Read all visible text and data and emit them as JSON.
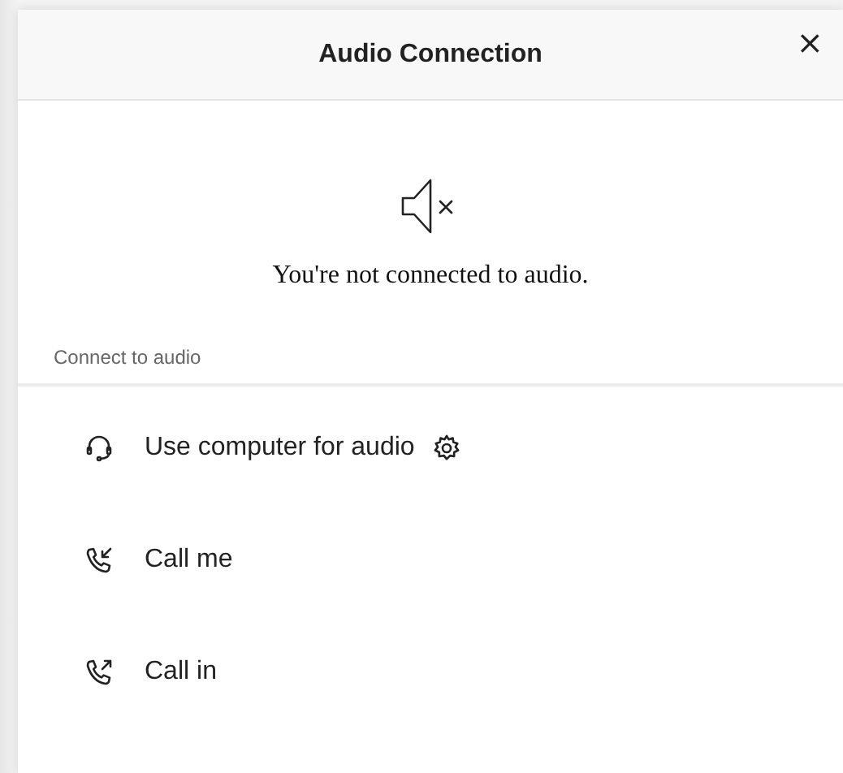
{
  "dialog": {
    "title": "Audio Connection",
    "close": "×"
  },
  "status": {
    "message": "You're not connected to audio."
  },
  "section": {
    "label": "Connect to audio"
  },
  "options": [
    {
      "kind": "headset",
      "label": "Use computer for audio",
      "settings": true
    },
    {
      "kind": "incoming",
      "label": "Call me",
      "settings": false
    },
    {
      "kind": "outgoing",
      "label": "Call in",
      "settings": false
    }
  ]
}
